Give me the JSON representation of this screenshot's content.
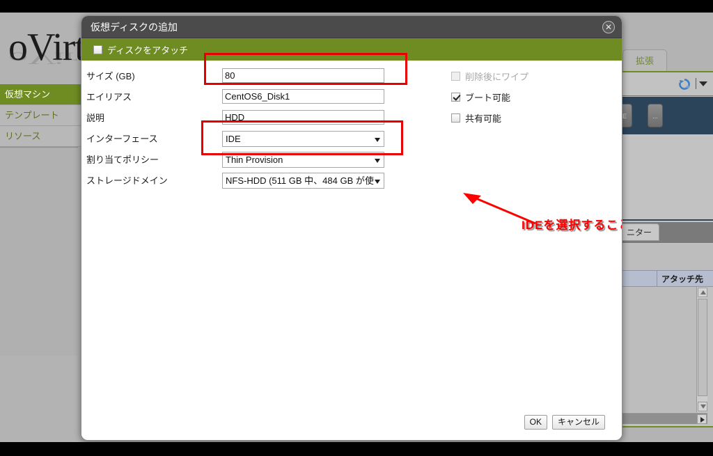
{
  "app": {
    "logo": "oVirt",
    "nav_items": [
      {
        "label": "仮想マシン",
        "selected": true
      },
      {
        "label": "テンプレート",
        "selected": false
      },
      {
        "label": "リソース",
        "selected": false
      }
    ],
    "tab_label": "拡張",
    "refresh_icon": "refresh-icon",
    "navy_buttons": [
      "E",
      "..."
    ],
    "monitor_tab_label": "ニター",
    "grid_column_header": "アタッチ先"
  },
  "dialog": {
    "title": "仮想ディスクの追加",
    "close_icon": "close-icon",
    "attach_disk": {
      "label": "ディスクをアタッチ",
      "checked": false
    },
    "fields": [
      {
        "label": "サイズ (GB)",
        "type": "text",
        "value": "80"
      },
      {
        "label": "エイリアス",
        "type": "text",
        "value": "CentOS6_Disk1"
      },
      {
        "label": "説明",
        "type": "text",
        "value": "HDD"
      },
      {
        "label": "インターフェース",
        "type": "select",
        "value": "IDE"
      },
      {
        "label": "割り当てポリシー",
        "type": "select",
        "value": "Thin Provision"
      },
      {
        "label": "ストレージドメイン",
        "type": "select",
        "value": "NFS-HDD (511 GB 中、484 GB が使"
      }
    ],
    "checkboxes": [
      {
        "label": "削除後にワイプ",
        "checked": false,
        "disabled": true
      },
      {
        "label": "ブート可能",
        "checked": true,
        "disabled": false
      },
      {
        "label": "共有可能",
        "checked": false,
        "disabled": false
      }
    ],
    "buttons": {
      "ok": "OK",
      "cancel": "キャンセル"
    }
  },
  "annotations": {
    "note_text": "IDEを選択すること。",
    "highlight_color": "#e60000",
    "note_color": "#ff0000"
  },
  "colors": {
    "accent_green": "#6f8c23",
    "title_bar": "#4b4b4b",
    "desktop": "#b3b3b3",
    "navy_panel": "#2c4459"
  }
}
